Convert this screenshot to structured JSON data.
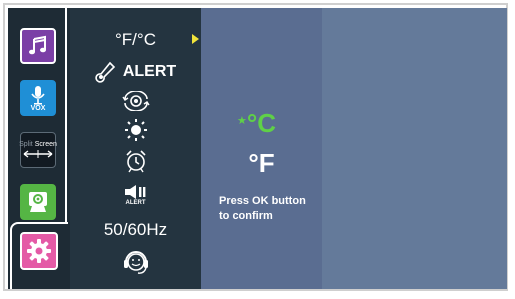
{
  "sidebar": {
    "apps": [
      {
        "name": "music",
        "icon": "music-note-icon"
      },
      {
        "name": "vox",
        "icon": "microphone-icon",
        "label": "VOX"
      },
      {
        "name": "split-screen",
        "icon": "split-screen-icon",
        "label_left": "Split",
        "label_right": "Screen"
      },
      {
        "name": "camera",
        "icon": "camera-icon"
      },
      {
        "name": "settings",
        "icon": "gear-icon",
        "selected": true
      }
    ]
  },
  "menu": {
    "unit_label": "°F/°C",
    "alert_label": "ALERT",
    "alert_small_label": "ALERT",
    "frequency_label": "50/60Hz",
    "icons": [
      "thermometer-icon",
      "camera-rotate-icon",
      "brightness-icon",
      "alarm-clock-icon",
      "speaker-alert-icon",
      "headset-icon"
    ]
  },
  "options": {
    "celsius": "°C",
    "fahrenheit": "°F",
    "selected_marker": "★"
  },
  "hint": "Press OK button to confirm",
  "colors": {
    "selected_option": "#5fd047",
    "selection_arrow": "#f0e33b",
    "settings_app": "#e45aa6"
  }
}
